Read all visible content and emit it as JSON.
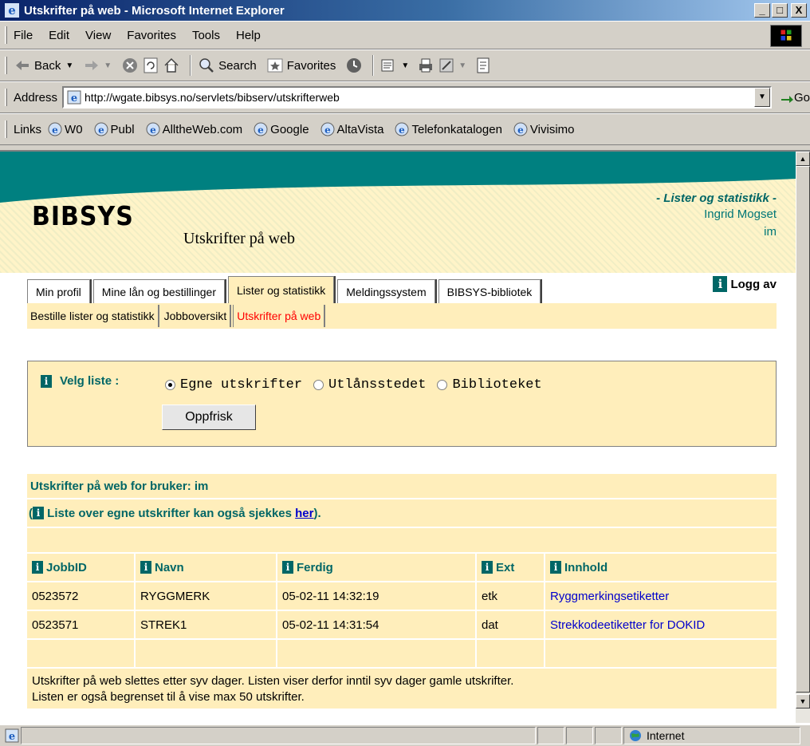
{
  "window": {
    "title": "Utskrifter på web - Microsoft Internet Explorer",
    "buttons": [
      "_",
      "□",
      "X"
    ]
  },
  "menubar": {
    "items": [
      "File",
      "Edit",
      "View",
      "Favorites",
      "Tools",
      "Help"
    ]
  },
  "toolbar": {
    "back": "Back",
    "search": "Search",
    "favorites": "Favorites"
  },
  "address": {
    "label": "Address",
    "url": "http://wgate.bibsys.no/servlets/bibserv/utskrifterweb",
    "go": "Go"
  },
  "links": {
    "label": "Links",
    "items": [
      "W0",
      "Publ",
      "AlltheWeb.com",
      "Google",
      "AltaVista",
      "Telefonkatalogen",
      "Vivisimo"
    ]
  },
  "page": {
    "logo": "BIBSYS",
    "title": "Utskrifter på web",
    "section": "- Lister og statistikk -",
    "user_name": "Ingrid Mogset",
    "user_id": "im",
    "tabs": [
      "Min profil",
      "Mine lån og bestillinger",
      "Lister og statistikk",
      "Meldingssystem",
      "BIBSYS-bibliotek"
    ],
    "active_tab": 2,
    "logout": "Logg av",
    "subtabs": [
      "Bestille lister og statistikk",
      "Jobboversikt",
      "Utskrifter på web"
    ],
    "active_subtab": 2,
    "choose": {
      "label": "Velg liste :",
      "options": [
        "Egne utskrifter",
        "Utlånsstedet",
        "Biblioteket"
      ],
      "selected": 0,
      "refresh": "Oppfrisk"
    },
    "results": {
      "title": "Utskrifter på web for bruker: im",
      "note_open": "(",
      "note_text": " Liste over egne utskrifter kan også sjekkes ",
      "note_link": "her",
      "note_close": ").",
      "columns": [
        "JobbID",
        "Navn",
        "Ferdig",
        "Ext",
        "Innhold"
      ],
      "rows": [
        [
          "0523572",
          "RYGGMERK",
          "05-02-11 14:32:19",
          "etk",
          "Ryggmerkingsetiketter"
        ],
        [
          "0523571",
          "STREK1",
          "05-02-11 14:31:54",
          "dat",
          "Strekkodeetiketter for DOKID"
        ]
      ],
      "footer_line1": "Utskrifter på web slettes etter syv dager. Listen viser derfor inntil syv dager gamle utskrifter.",
      "footer_line2": "Listen er også begrenset til å vise max 50 utskrifter."
    }
  },
  "status": {
    "zone": "Internet"
  },
  "icons": {
    "info": "i"
  }
}
